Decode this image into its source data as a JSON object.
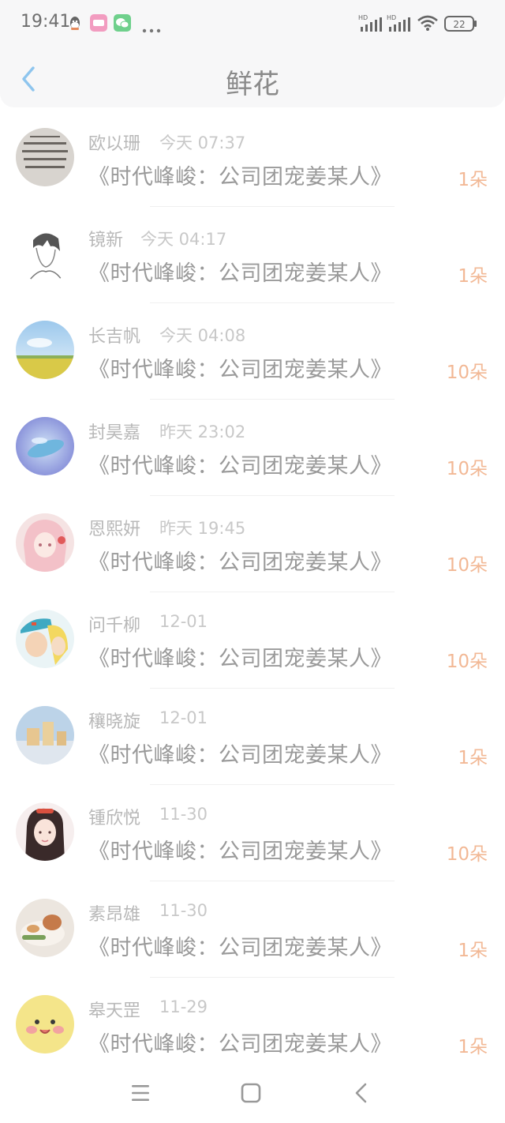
{
  "status": {
    "time": "19:41",
    "hd1": "HD",
    "hd2": "HD",
    "battery": "22",
    "icons": [
      "qq-icon",
      "app-icon",
      "wechat-icon",
      "more-dots-icon",
      "signal-icon",
      "wifi-icon",
      "battery-icon"
    ]
  },
  "header": {
    "title": "鲜花"
  },
  "items": [
    {
      "name": "欧以珊",
      "time": "今天 07:37",
      "book": "《时代峰峻：公司团宠姜某人》",
      "count": "1朵"
    },
    {
      "name": "镜新",
      "time": "今天 04:17",
      "book": "《时代峰峻：公司团宠姜某人》",
      "count": "1朵"
    },
    {
      "name": "长吉帆",
      "time": "今天 04:08",
      "book": "《时代峰峻：公司团宠姜某人》",
      "count": "10朵"
    },
    {
      "name": "封昊嘉",
      "time": "昨天 23:02",
      "book": "《时代峰峻：公司团宠姜某人》",
      "count": "10朵"
    },
    {
      "name": "恩熙妍",
      "time": "昨天 19:45",
      "book": "《时代峰峻：公司团宠姜某人》",
      "count": "10朵"
    },
    {
      "name": "问千柳",
      "time": "12-01",
      "book": "《时代峰峻：公司团宠姜某人》",
      "count": "10朵"
    },
    {
      "name": "穰晓旋",
      "time": "12-01",
      "book": "《时代峰峻：公司团宠姜某人》",
      "count": "1朵"
    },
    {
      "name": "锺欣悦",
      "time": "11-30",
      "book": "《时代峰峻：公司团宠姜某人》",
      "count": "10朵"
    },
    {
      "name": "素昂雄",
      "time": "11-30",
      "book": "《时代峰峻：公司团宠姜某人》",
      "count": "1朵"
    },
    {
      "name": "皋天罡",
      "time": "11-29",
      "book": "《时代峰峻：公司团宠姜某人》",
      "count": "1朵"
    }
  ],
  "colors": {
    "accent_count": "#f2b895",
    "back_arrow": "#8ec5ee"
  }
}
